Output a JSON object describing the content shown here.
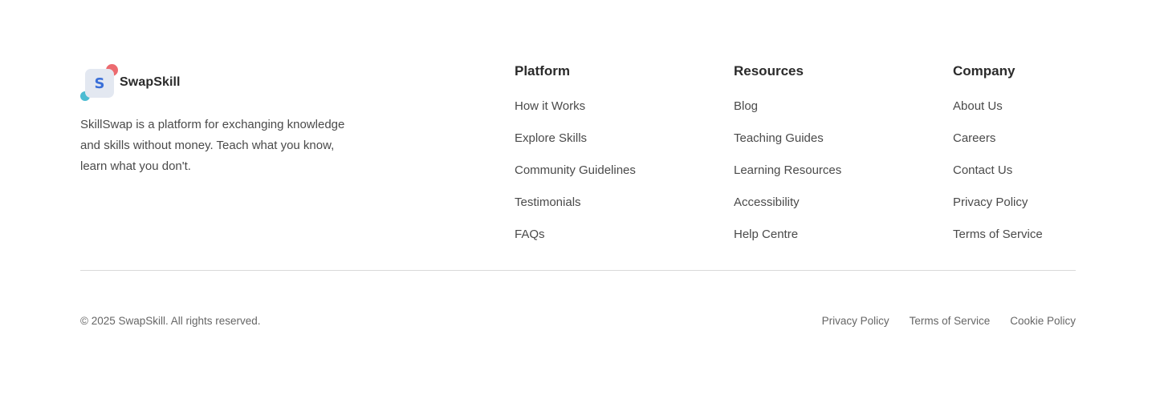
{
  "brand": {
    "logo_letter": "S",
    "name": "SwapSkill",
    "description": "SkillSwap is a platform for exchanging knowledge and skills without money. Teach what you know, learn what you don't.",
    "colors": {
      "logo_bg": "#e3e8f1",
      "logo_letter": "#3a6fd8",
      "dot_red": "#ec6b70",
      "dot_teal": "#4cbcd2"
    }
  },
  "columns": [
    {
      "title": "Platform",
      "links": [
        "How it Works",
        "Explore Skills",
        "Community Guidelines",
        "Testimonials",
        "FAQs"
      ]
    },
    {
      "title": "Resources",
      "links": [
        "Blog",
        "Teaching Guides",
        "Learning Resources",
        "Accessibility",
        "Help Centre"
      ]
    },
    {
      "title": "Company",
      "links": [
        "About Us",
        "Careers",
        "Contact Us",
        "Privacy Policy",
        "Terms of Service"
      ]
    }
  ],
  "bottom": {
    "copyright": "© 2025 SwapSkill. All rights reserved.",
    "legal_links": [
      "Privacy Policy",
      "Terms of Service",
      "Cookie Policy"
    ]
  }
}
